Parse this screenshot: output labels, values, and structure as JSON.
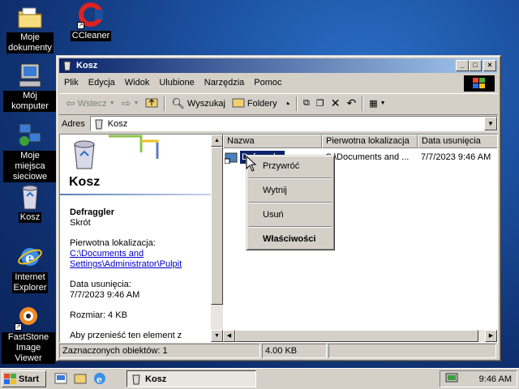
{
  "desktop": {
    "icons": [
      {
        "label_line1": "Moje",
        "label_line2": "dokumenty",
        "icon": "folder-documents-icon"
      },
      {
        "label_line1": "CCleaner",
        "icon": "ccleaner-icon"
      },
      {
        "label_line1": "Mój komputer",
        "icon": "my-computer-icon"
      },
      {
        "label_line1": "Moje miejsca",
        "label_line2": "sieciowe",
        "icon": "network-places-icon"
      },
      {
        "label_line1": "Kosz",
        "icon": "recycle-bin-icon"
      },
      {
        "label_line1": "Internet",
        "label_line2": "Explorer",
        "icon": "internet-explorer-icon"
      },
      {
        "label_line1": "FastStone",
        "label_line2": "Image Viewer",
        "icon": "faststone-icon"
      }
    ]
  },
  "window": {
    "title": "Kosz",
    "menu": [
      "Plik",
      "Edycja",
      "Widok",
      "Ulubione",
      "Narzędzia",
      "Pomoc"
    ],
    "toolbar": {
      "back_label": "Wstecz",
      "search_label": "Wyszukaj",
      "folders_label": "Foldery"
    },
    "address": {
      "label": "Adres",
      "value": "Kosz"
    },
    "left_panel": {
      "heading": "Kosz",
      "item_name": "Defraggler",
      "item_type": "Skrót",
      "orig_location_label": "Pierwotna lokalizacja:",
      "orig_location_value": "C:\\Documents and Settings\\Administrator\\Pulpit",
      "deleted_label": "Data usunięcia:",
      "deleted_value": "7/7/2023 9:46 AM",
      "size_text": "Rozmiar: 4 KB",
      "restore_hint": "Aby przenieść ten element z"
    },
    "columns": [
      "Nazwa",
      "Pierwotna lokalizacja",
      "Data usunięcia"
    ],
    "rows": [
      {
        "name": "Defraggler",
        "location": "C:\\Documents and ...",
        "deleted": "7/7/2023 9:46 AM"
      }
    ],
    "status": {
      "selected": "Zaznaczonych obiektów: 1",
      "size": "4.00 KB"
    }
  },
  "context_menu": {
    "items": [
      "Przywróć",
      "Wytnij",
      "Usuń",
      "Właściwości"
    ]
  },
  "taskbar": {
    "start_label": "Start",
    "task_label": "Kosz",
    "clock": "9:46 AM"
  }
}
